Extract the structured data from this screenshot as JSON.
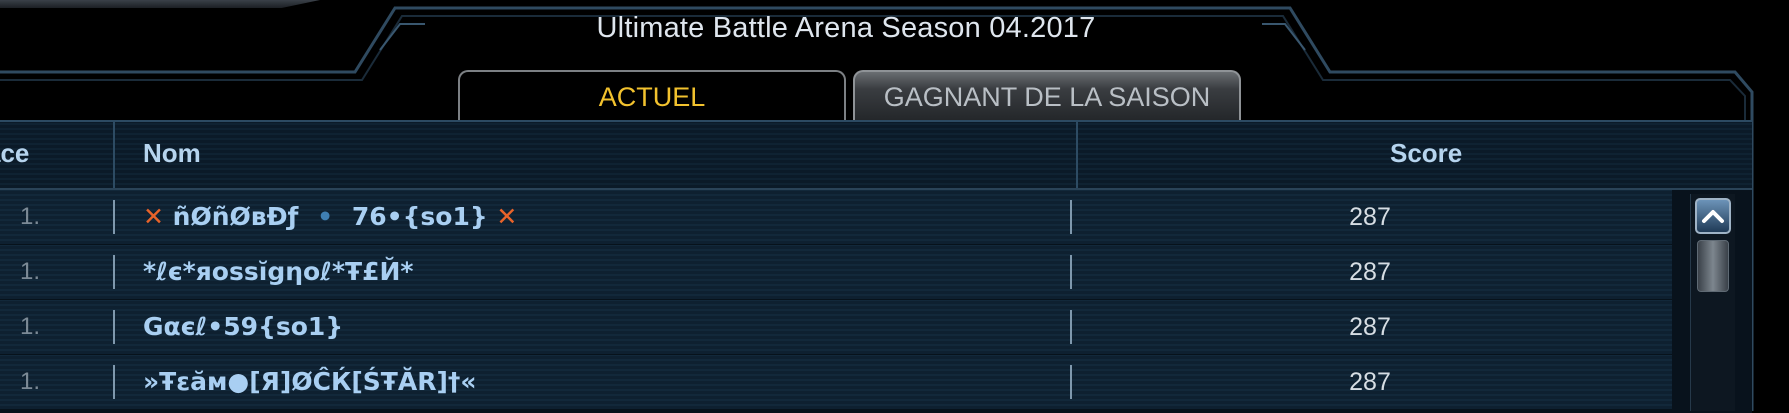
{
  "title": "Ultimate Battle Arena Season 04.2017",
  "tabs": {
    "current": "ACTUEL",
    "season_winner": "GAGNANT DE LA SAISON"
  },
  "table": {
    "headers": {
      "place": "ace",
      "name": "Nom",
      "score": "Score"
    },
    "rows": [
      {
        "rank": "1.",
        "name_parts": [
          "ñØñØвĐƒ",
          "76•{so1}"
        ],
        "score": "287"
      },
      {
        "rank": "1.",
        "name": "*ℓє*яossĭgηoℓ*Ŧ£Й*",
        "score": "287"
      },
      {
        "rank": "1.",
        "name": "Gαєℓ•59{so1}",
        "score": "287"
      },
      {
        "rank": "1.",
        "name": "»Ŧεăм●[Я]ØĈЌ[ŚŦĂR]†«",
        "score": "287"
      }
    ]
  },
  "icons": {
    "badge_left": "x-icon",
    "badge_right": "x-icon",
    "separator": "dot-icon",
    "scroll_up": "chevron-up-icon"
  },
  "colors": {
    "active_tab_text": "#f2c22e",
    "header_text": "#b6d4ee",
    "name_text": "#a9cff2",
    "badge": "#e8632a"
  }
}
